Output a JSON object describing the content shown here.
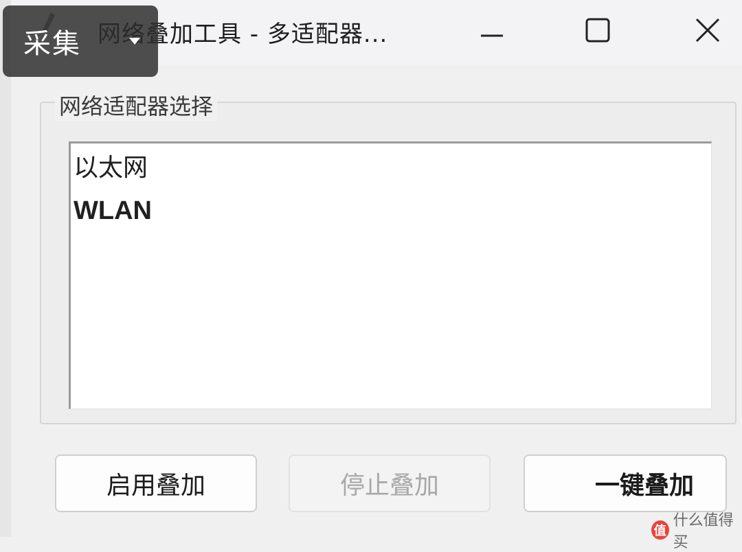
{
  "window": {
    "title": "网络叠加工具 - 多适配器...",
    "controls": {
      "minimize_icon": "minimize-icon",
      "maximize_icon": "maximize-icon",
      "close_icon": "close-icon"
    }
  },
  "overlay_badge": {
    "label": "采集"
  },
  "adapter_group": {
    "label": "网络适配器选择",
    "items": [
      "以太网",
      "WLAN"
    ]
  },
  "buttons": {
    "enable": "启用叠加",
    "stop": "停止叠加",
    "one_click": "一键叠加"
  },
  "watermark": {
    "logo_char": "值",
    "text": "什么值得买"
  },
  "colors": {
    "background": "#f0f0f0",
    "disabled_text": "#a8a8a8",
    "badge_bg": "#2d2d2d"
  }
}
